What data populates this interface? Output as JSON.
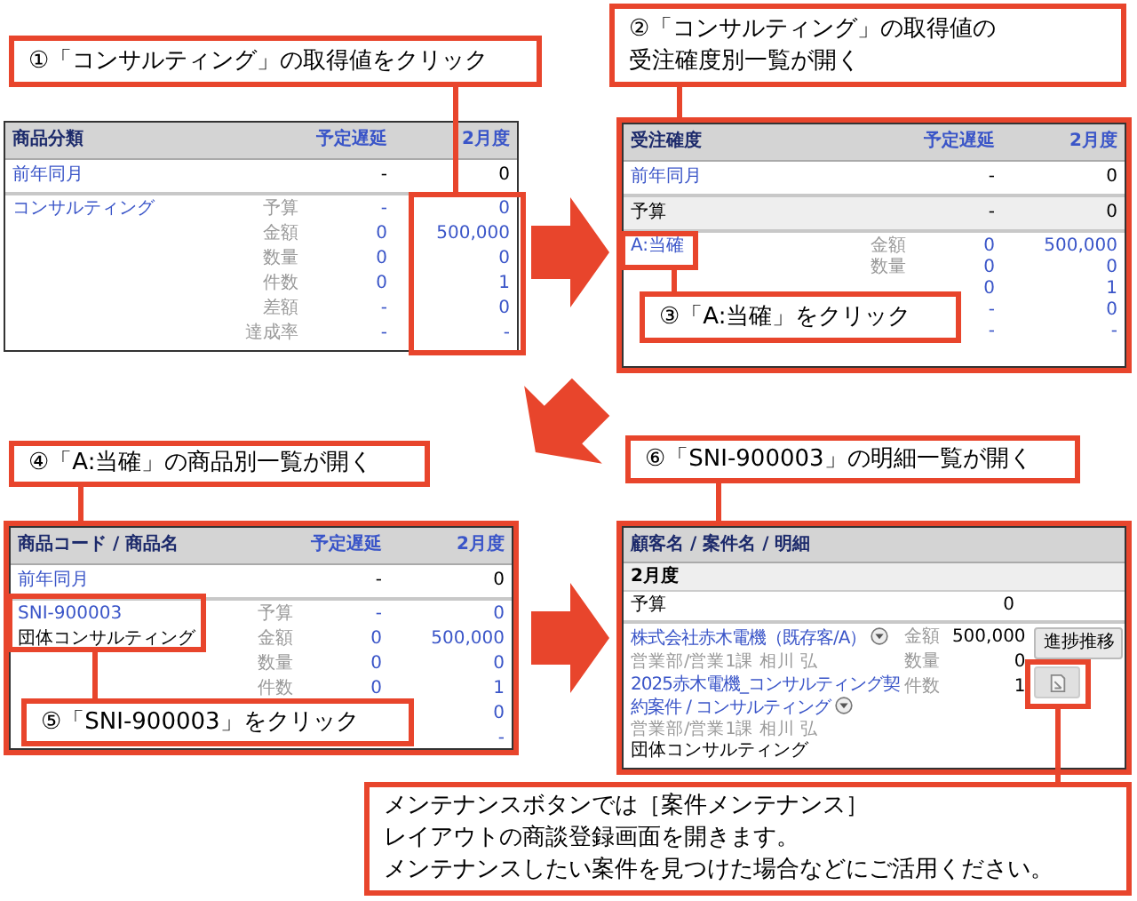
{
  "callouts": [
    {
      "lines": [
        "①「コンサルティング」の取得値をクリック"
      ]
    },
    {
      "lines": [
        "②「コンサルティング」の取得値の",
        "受注確度別一覧が開く"
      ]
    },
    {
      "lines": [
        "③「A:当確」をクリック"
      ]
    },
    {
      "lines": [
        "④「A:当確」の商品別一覧が開く"
      ]
    },
    {
      "lines": [
        "⑤「SNI-900003」をクリック"
      ]
    },
    {
      "lines": [
        "⑥「SNI-900003」の明細一覧が開く"
      ]
    },
    {
      "lines": [
        "メンテナンスボタンでは［案件メンテナンス］",
        "レイアウトの商談登録画面を開きます。",
        "メンテナンスしたい案件を見つけた場合などにご活用ください。"
      ]
    }
  ],
  "panels": [
    {
      "kind": "summary",
      "framed": false,
      "columns": [
        "商品分類",
        "予定遅延",
        "2月度"
      ],
      "rows": [
        {
          "kind": "simple",
          "label": "前年同月",
          "link": true,
          "shaded": false,
          "values": [
            "-",
            "0"
          ]
        },
        {
          "kind": "group",
          "label": "コンサルティング",
          "values_highlighted": true,
          "metrics": [
            {
              "name": "予算",
              "planned": "-",
              "month": "0"
            },
            {
              "name": "金額",
              "planned": "0",
              "month": "500,000"
            },
            {
              "name": "数量",
              "planned": "0",
              "month": "0"
            },
            {
              "name": "件数",
              "planned": "0",
              "month": "1"
            },
            {
              "name": "差額",
              "planned": "-",
              "month": "0"
            },
            {
              "name": "達成率",
              "planned": "-",
              "month": "-"
            }
          ]
        }
      ]
    },
    {
      "kind": "summary",
      "framed": true,
      "columns": [
        "受注確度",
        "予定遅延",
        "2月度"
      ],
      "rows": [
        {
          "kind": "simple",
          "label": "前年同月",
          "link": true,
          "shaded": false,
          "values": [
            "-",
            "0"
          ]
        },
        {
          "kind": "simple",
          "label": "予算",
          "link": false,
          "shaded": true,
          "values": [
            "-",
            "0"
          ]
        },
        {
          "kind": "group",
          "label": "A:当確",
          "label_highlighted": true,
          "metrics": [
            {
              "name": "金額",
              "planned": "0",
              "month": "500,000"
            },
            {
              "name": "数量",
              "planned": "0",
              "month": "0"
            },
            {
              "planned": "0",
              "month": "1"
            },
            {
              "planned": "-",
              "month": "0"
            },
            {
              "planned": "-",
              "month": "-"
            }
          ]
        }
      ]
    },
    {
      "kind": "summary",
      "framed": true,
      "columns": [
        "商品コード / 商品名",
        "予定遅延",
        "2月度"
      ],
      "rows": [
        {
          "kind": "simple",
          "label": "前年同月",
          "link": true,
          "shaded": false,
          "values": [
            "-",
            "0"
          ]
        },
        {
          "kind": "group",
          "label": "SNI-900003",
          "sublabel": "団体コンサルティング",
          "label_highlighted": true,
          "metrics": [
            {
              "name": "予算",
              "planned": "-",
              "month": "0"
            },
            {
              "name": "金額",
              "planned": "0",
              "month": "500,000"
            },
            {
              "name": "数量",
              "planned": "0",
              "month": "0"
            },
            {
              "name": "件数",
              "planned": "0",
              "month": "1"
            },
            {
              "month": "0"
            },
            {
              "month": "-"
            }
          ]
        }
      ]
    },
    {
      "kind": "detail",
      "framed": true,
      "header": "顧客名 / 案件名 / 明細",
      "period": "2月度",
      "budget": {
        "label": "予算",
        "value": "0"
      },
      "deal": {
        "customer": "株式会社赤木電機（既存客/A）",
        "customer_owner": "営業部/営業1課 相川 弘",
        "deal_name": "2025赤木電機_コンサルティング契約案件 / コンサルティング",
        "deal_owner": "営業部/営業1課 相川 弘",
        "product": "団体コンサルティング",
        "metrics": [
          {
            "name": "金額",
            "value": "500,000"
          },
          {
            "name": "数量",
            "value": "0"
          },
          {
            "name": "件数",
            "value": "1"
          }
        ],
        "button": "進捗推移",
        "maintenance_highlighted": true
      }
    }
  ]
}
